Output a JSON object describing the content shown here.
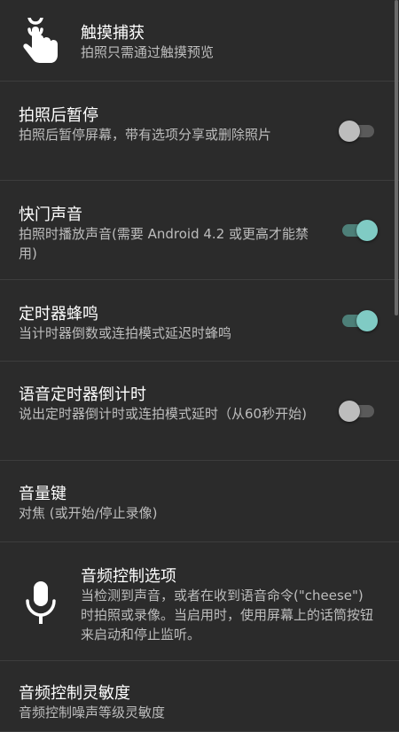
{
  "settings": {
    "touch_capture": {
      "title": "触摸捕获",
      "summary": "拍照只需通过触摸预览",
      "icon": "touch-hand-icon"
    },
    "pause_after_photo": {
      "title": "拍照后暂停",
      "summary": "拍照后暂停屏幕，带有选项分享或删除照片",
      "enabled": false
    },
    "shutter_sound": {
      "title": "快门声音",
      "summary": "拍照时播放声音(需要 Android 4.2 或更高才能禁用)",
      "enabled": true
    },
    "timer_beep": {
      "title": "定时器蜂鸣",
      "summary": "当计时器倒数或连拍模式延迟时蜂鸣",
      "enabled": true
    },
    "voice_timer": {
      "title": "语音定时器倒计时",
      "summary": "说出定时器倒计时或连拍模式延时（从60秒开始)",
      "enabled": false
    },
    "volume_keys": {
      "title": "音量键",
      "summary": "对焦 (或开始/停止录像)"
    },
    "audio_control": {
      "title": "音频控制选项",
      "summary": "当检测到声音，或者在收到语音命令(\"cheese\")时拍照或录像。当启用时，使用屏幕上的话筒按钮来启动和停止监听。",
      "icon": "microphone-icon"
    },
    "audio_sensitivity": {
      "title": "音频控制灵敏度",
      "summary": "音频控制噪声等级灵敏度"
    }
  },
  "colors": {
    "background": "#2b2b2b",
    "divider": "#3d3d3d",
    "accent": "#80cbc4"
  }
}
